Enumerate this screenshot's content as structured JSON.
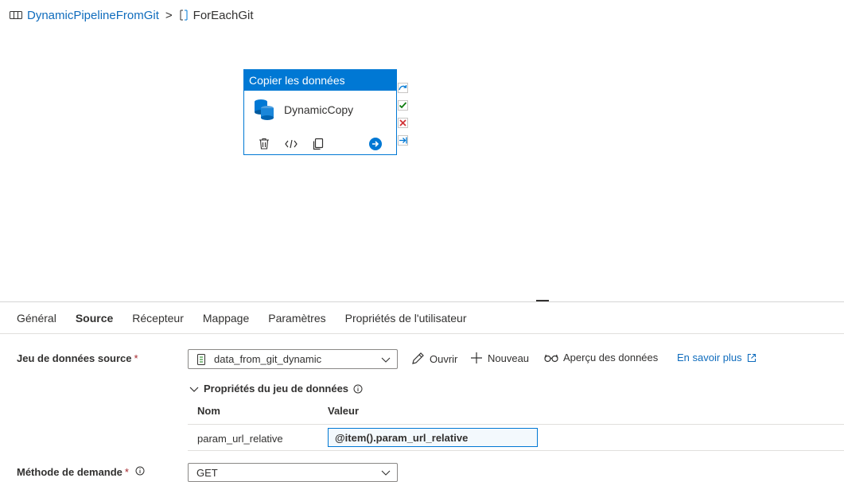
{
  "breadcrumb": {
    "pipeline": "DynamicPipelineFromGit",
    "separator": ">",
    "current": "ForEachGit"
  },
  "activity": {
    "type": "Copier les données",
    "name": "DynamicCopy"
  },
  "tabs": [
    "Général",
    "Source",
    "Récepteur",
    "Mappage",
    "Paramètres",
    "Propriétés de l'utilisateur"
  ],
  "active_tab": "Source",
  "source": {
    "dataset_label": "Jeu de données source",
    "dataset_value": "data_from_git_dynamic",
    "open_label": "Ouvrir",
    "new_label": "Nouveau",
    "preview_label": "Aperçu des données",
    "learn_more": "En savoir plus",
    "dataset_props_label": "Propriétés du jeu de données",
    "col_name": "Nom",
    "col_value": "Valeur",
    "param_name": "param_url_relative",
    "param_value": "@item().param_url_relative",
    "method_label": "Méthode de demande",
    "method_value": "GET"
  },
  "required_marker": "*",
  "colors": {
    "accent": "#0078d4",
    "link": "#0f6cbd",
    "required": "#a4262c"
  }
}
